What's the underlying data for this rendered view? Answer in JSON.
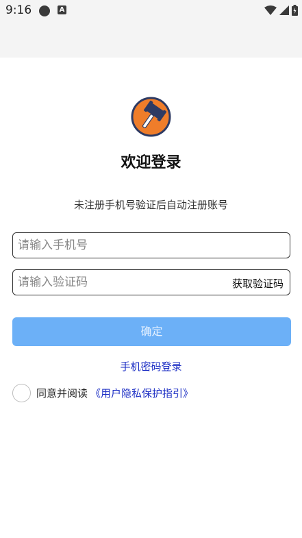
{
  "status_bar": {
    "time": "9:16",
    "icons": [
      "record-dot-icon",
      "a-badge-icon",
      "wifi-icon",
      "signal-icon",
      "battery-icon"
    ]
  },
  "login": {
    "title": "欢迎登录",
    "subtitle": "未注册手机号验证后自动注册账号",
    "phone_placeholder": "请输入手机号",
    "code_placeholder": "请输入验证码",
    "get_code_label": "获取验证码",
    "confirm_label": "确定",
    "password_login_label": "手机密码登录",
    "agree_text": "同意并阅读",
    "privacy_link": "《用户隐私保护指引》"
  },
  "colors": {
    "accent": "#6cb0f7",
    "link": "#1d2fc4",
    "logo_bg": "#ef7d2a",
    "logo_ring": "#2d3a63"
  }
}
